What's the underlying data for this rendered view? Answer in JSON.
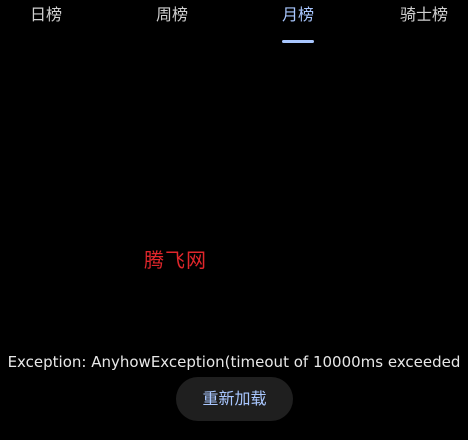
{
  "tabs": [
    {
      "label": "日榜",
      "active": false
    },
    {
      "label": "周榜",
      "active": false
    },
    {
      "label": "月榜",
      "active": true
    },
    {
      "label": "骑士榜",
      "active": false
    }
  ],
  "watermark": {
    "text": "腾飞网"
  },
  "error": {
    "message": "Exception: AnyhowException(timeout of 10000ms exceeded"
  },
  "actions": {
    "reload_label": "重新加载"
  },
  "colors": {
    "background": "#000000",
    "accent": "#a9c7ff",
    "watermark": "#e0262b",
    "button_background": "#1f1f1f"
  }
}
